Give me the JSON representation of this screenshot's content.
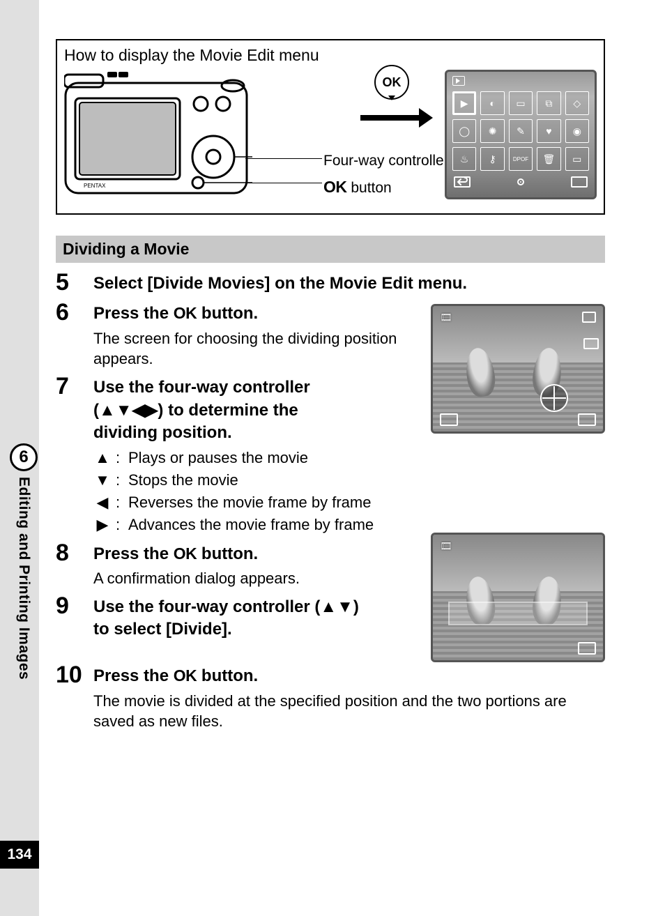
{
  "page_number": "134",
  "side_tab": {
    "chapter": "6",
    "title": "Editing and Printing Images"
  },
  "howto": {
    "title": "How to display the Movie Edit menu",
    "label_controller": "Four-way controller",
    "label_ok_button_prefix": "OK",
    "label_ok_button_suffix": " button",
    "ok_badge": "OK"
  },
  "lcd_icons": {
    "row1": [
      "play",
      "contrast",
      "crop",
      "resize",
      "rotate"
    ],
    "row2": [
      "oval",
      "sun",
      "magic",
      "heart",
      "eye"
    ],
    "row3": [
      "cup",
      "key",
      "dpof",
      "trash",
      "info"
    ]
  },
  "section_title": "Dividing a Movie",
  "steps": {
    "s5": {
      "num": "5",
      "head": "Select [Divide Movies] on the Movie Edit menu."
    },
    "s6": {
      "num": "6",
      "head_prefix": "Press the ",
      "head_ok": "OK",
      "head_suffix": " button.",
      "sub": "The screen for choosing the dividing position appears."
    },
    "s7": {
      "num": "7",
      "head_l1": "Use the four-way controller ",
      "head_l2a": "(",
      "head_l2b": ") to determine the ",
      "head_l3": "dividing position.",
      "ctrl_up": "Plays or pauses the movie",
      "ctrl_down": "Stops the movie",
      "ctrl_left": "Reverses the movie frame by frame",
      "ctrl_right": "Advances the movie frame by frame"
    },
    "s8": {
      "num": "8",
      "head_prefix": "Press the ",
      "head_ok": "OK",
      "head_suffix": " button.",
      "sub": "A confirmation dialog appears."
    },
    "s9": {
      "num": "9",
      "head_l1": "Use the four-way controller (",
      "head_l2": ") ",
      "head_l3": "to select [Divide]."
    },
    "s10": {
      "num": "10",
      "head_prefix": "Press the ",
      "head_ok": "OK",
      "head_suffix": " button.",
      "sub": "The movie is divided at the specified position and the two portions are saved as new files."
    }
  }
}
